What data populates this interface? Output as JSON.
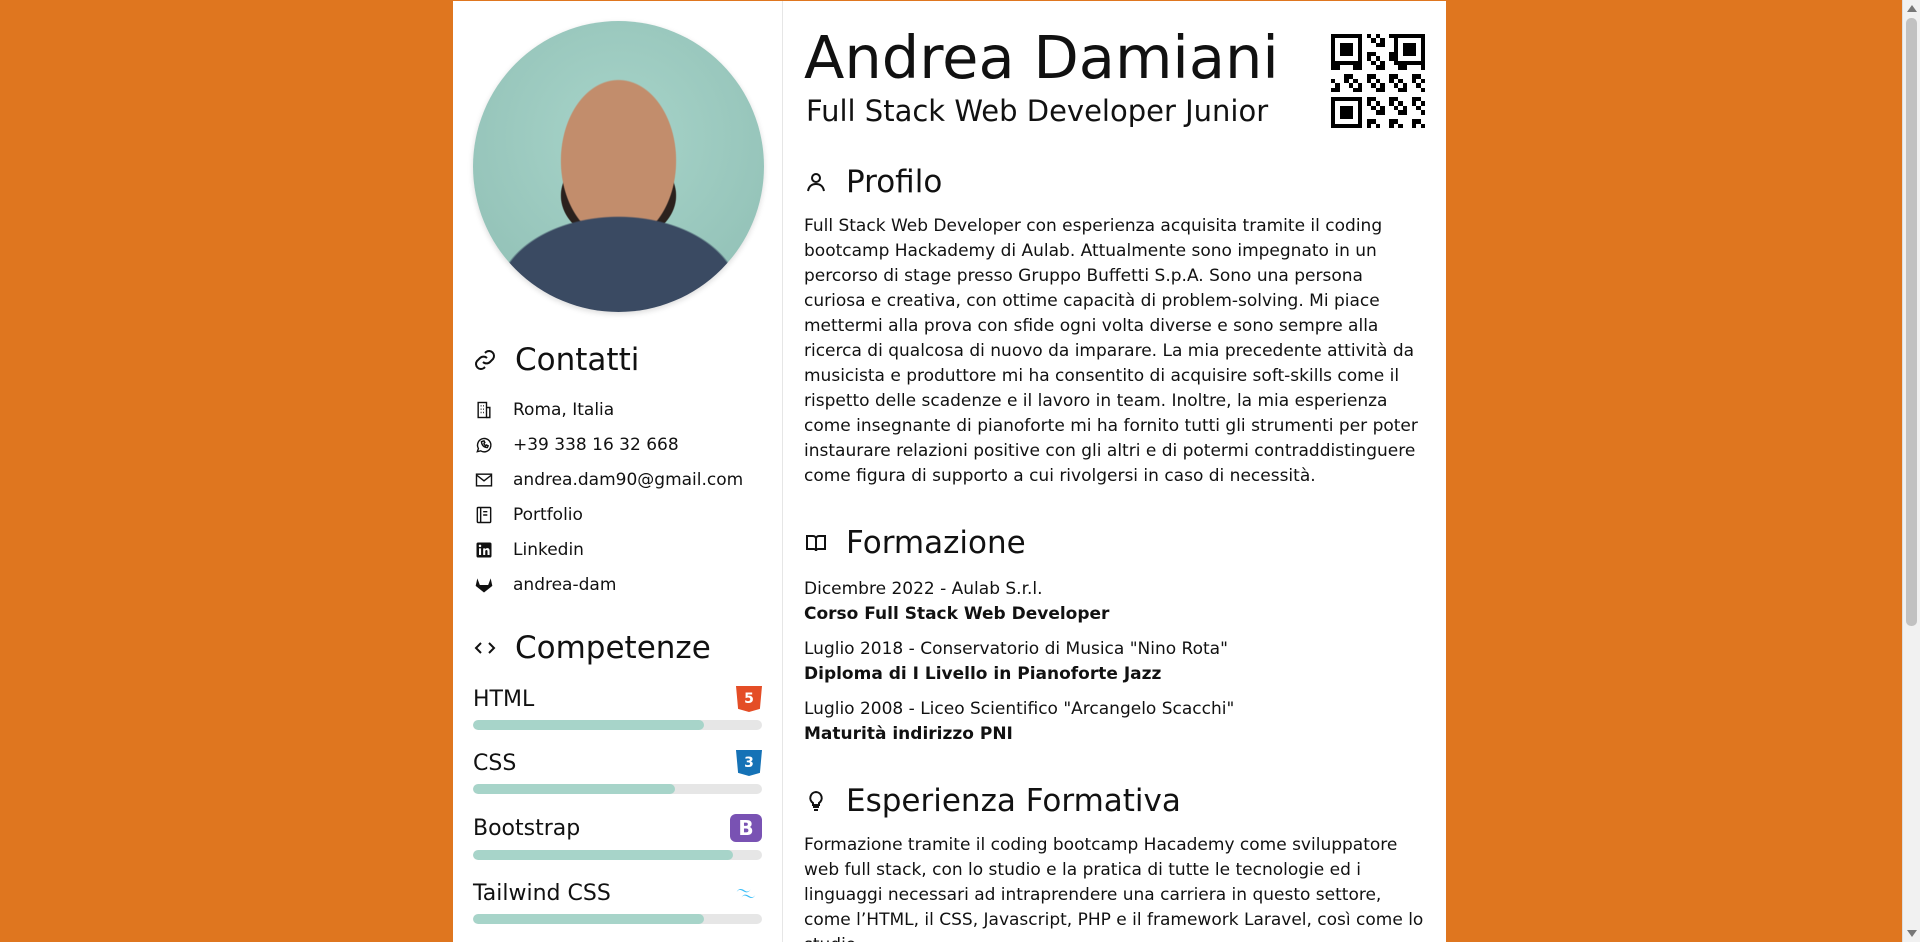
{
  "sidebar": {
    "contacts_title": "Contatti",
    "contacts": [
      {
        "icon": "building-icon",
        "text": "Roma, Italia"
      },
      {
        "icon": "whatsapp-icon",
        "text": "+39 338 16 32 668"
      },
      {
        "icon": "mail-icon",
        "text": "andrea.dam90@gmail.com"
      },
      {
        "icon": "portfolio-icon",
        "text": "Portfolio"
      },
      {
        "icon": "linkedin-icon",
        "text": "Linkedin"
      },
      {
        "icon": "gitlab-icon",
        "text": "andrea-dam"
      }
    ],
    "skills_title": "Competenze",
    "skills": [
      {
        "name": "HTML",
        "icon": "html5-icon",
        "level": 80
      },
      {
        "name": "CSS",
        "icon": "css3-icon",
        "level": 70
      },
      {
        "name": "Bootstrap",
        "icon": "bootstrap-icon",
        "level": 90
      },
      {
        "name": "Tailwind CSS",
        "icon": "tailwind-icon",
        "level": 80
      }
    ],
    "skill_color": "#a7d4c9"
  },
  "header": {
    "name": "Andrea Damiani",
    "subtitle": "Full Stack Web Developer Junior"
  },
  "profile": {
    "title": "Profilo",
    "text": "Full Stack Web Developer con esperienza acquisita tramite il coding bootcamp Hackademy di Aulab. Attualmente sono impegnato in un percorso di stage presso Gruppo Buffetti S.p.A. Sono una persona curiosa e creativa, con ottime capacità di problem-solving. Mi piace mettermi alla prova con sfide ogni volta diverse e sono sempre alla ricerca di qualcosa di nuovo da imparare. La mia precedente attività da musicista e produttore mi ha consentito di acquisire soft-skills come il rispetto delle scadenze e il lavoro in team. Inoltre, la mia esperienza come insegnante di pianoforte mi ha fornito tutti gli strumenti per poter instaurare relazioni positive con gli altri e di potermi contraddistinguere come figura di supporto a cui rivolgersi in caso di necessità."
  },
  "education": {
    "title": "Formazione",
    "items": [
      {
        "date": "Dicembre 2022 - Aulab S.r.l.",
        "title": "Corso Full Stack Web Developer"
      },
      {
        "date": "Luglio 2018 - Conservatorio di Musica \"Nino Rota\"",
        "title": "Diploma di I Livello in Pianoforte Jazz"
      },
      {
        "date": "Luglio 2008 - Liceo Scientifico \"Arcangelo Scacchi\"",
        "title": "Maturità indirizzo PNI"
      }
    ]
  },
  "experience": {
    "title": "Esperienza Formativa",
    "text": "Formazione tramite il coding bootcamp Hacademy come sviluppatore web full stack, con lo studio e la pratica di tutte le tecnologie ed i linguaggi necessari ad intraprendere una carriera in questo settore, come l’HTML, il CSS, Javascript, PHP e il framework Laravel, così come lo studio"
  },
  "colors": {
    "background": "#df761f",
    "accent": "#a7d4c9"
  }
}
